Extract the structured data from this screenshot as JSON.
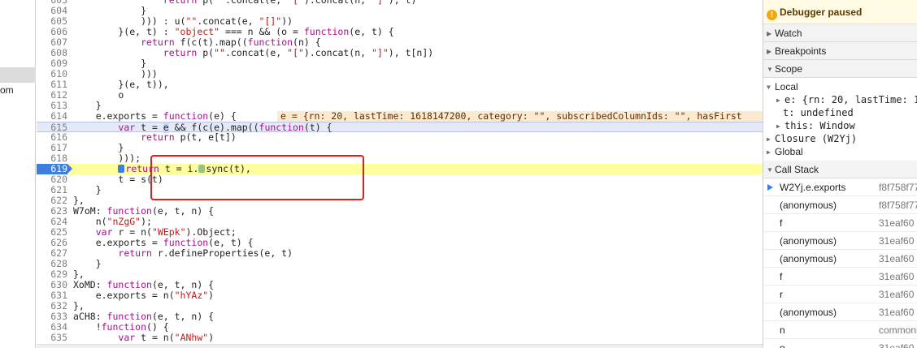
{
  "editor": {
    "lines": [
      {
        "n": "603",
        "html": "                return p(\"\".concat(e, \"[\").concat(n, \"]\"), t)"
      },
      {
        "n": "604",
        "html": "            }"
      },
      {
        "n": "605",
        "html": "            ))) : u(\"\".concat(e, \"[]\"))"
      },
      {
        "n": "606",
        "html": "        }(e, t) : \"object\" === n && (o = function(e, t) {"
      },
      {
        "n": "607",
        "html": "            return f(c(t).map((function(n) {"
      },
      {
        "n": "608",
        "html": "                return p(\"\".concat(e, \"[\").concat(n, \"]\"), t[n])"
      },
      {
        "n": "609",
        "html": "            }"
      },
      {
        "n": "610",
        "html": "            )))"
      },
      {
        "n": "611",
        "html": "        }(e, t)),"
      },
      {
        "n": "612",
        "html": "        o"
      },
      {
        "n": "613",
        "html": "    }"
      },
      {
        "n": "614",
        "html": "    e.exports = function(e) {"
      },
      {
        "n": "615",
        "html": "        var t = e && f(c(e).map((function(t) {"
      },
      {
        "n": "616",
        "html": "            return p(t, e[t])"
      },
      {
        "n": "617",
        "html": "        }"
      },
      {
        "n": "618",
        "html": "        )));"
      },
      {
        "n": "619",
        "html": "        return t = i.Dsync(t),"
      },
      {
        "n": "620",
        "html": "        t = s(t)"
      },
      {
        "n": "621",
        "html": "    }"
      },
      {
        "n": "622",
        "html": "},"
      },
      {
        "n": "623",
        "html": "W7oM: function(e, t, n) {"
      },
      {
        "n": "624",
        "html": "    n(\"nZgG\");"
      },
      {
        "n": "625",
        "html": "    var r = n(\"WEpk\").Object;"
      },
      {
        "n": "626",
        "html": "    e.exports = function(e, t) {"
      },
      {
        "n": "627",
        "html": "        return r.defineProperties(e, t)"
      },
      {
        "n": "628",
        "html": "    }"
      },
      {
        "n": "629",
        "html": "},"
      },
      {
        "n": "630",
        "html": "XoMD: function(e, t, n) {"
      },
      {
        "n": "631",
        "html": "    e.exports = n(\"hYAz\")"
      },
      {
        "n": "632",
        "html": "},"
      },
      {
        "n": "633",
        "html": "aCH8: function(e, t, n) {"
      },
      {
        "n": "634",
        "html": "    !function() {"
      },
      {
        "n": "635",
        "html": "        var t = n(\"ANhw\")"
      }
    ],
    "inline_value": "e = {rn: 20, lastTime: 1618147200, category: \"\", subscribedColumnIds: \"\", hasFirst",
    "nav_fragment": "om"
  },
  "sidebar": {
    "paused_label": "Debugger paused",
    "sections": {
      "watch": "Watch",
      "breakpoints": "Breakpoints",
      "scope": "Scope",
      "call_stack": "Call Stack"
    },
    "scope": {
      "local_label": "Local",
      "e_line": "e: {rn: 20, lastTime: 1",
      "t_line": "t: undefined",
      "this_line": "this: Window",
      "closure_label": "Closure (W2Yj)",
      "global_label": "Global"
    },
    "frames": [
      {
        "fn": "W2Yj.e.exports",
        "loc": "f8f758f77"
      },
      {
        "fn": "(anonymous)",
        "loc": "f8f758f77"
      },
      {
        "fn": "f",
        "loc": "31eaf60"
      },
      {
        "fn": "(anonymous)",
        "loc": "31eaf60"
      },
      {
        "fn": "(anonymous)",
        "loc": "31eaf60"
      },
      {
        "fn": "f",
        "loc": "31eaf60"
      },
      {
        "fn": "r",
        "loc": "31eaf60"
      },
      {
        "fn": "(anonymous)",
        "loc": "31eaf60"
      },
      {
        "fn": "n",
        "loc": "commons.4"
      },
      {
        "fn": "o",
        "loc": "31eaf60"
      }
    ]
  },
  "colors": {
    "exec_line": "#fffe9c",
    "exec_gutter": "#3c7fe0",
    "annotation_box": "#e02020",
    "paused_banner": "#fffbe5"
  },
  "icons": [
    "warning-icon",
    "disclosure-triangle-icon",
    "current-frame-arrow-icon",
    "breakpoint-marker-icon"
  ]
}
